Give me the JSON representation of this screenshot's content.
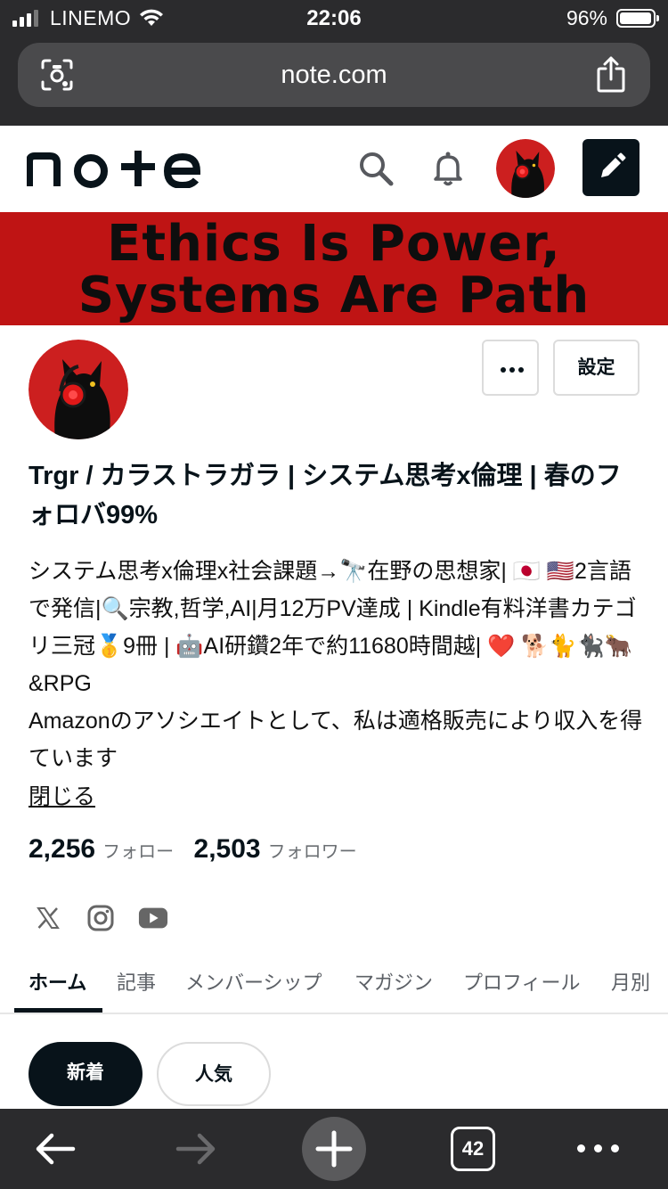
{
  "status_bar": {
    "carrier": "LINEMO",
    "time": "22:06",
    "battery_percent": "96%"
  },
  "browser": {
    "url": "note.com",
    "open_tabs": "42"
  },
  "header": {
    "logo": "note"
  },
  "banner": {
    "line1": "Ethics Is Power,",
    "line2": "Systems Are Path",
    "background": "#bf1414"
  },
  "profile": {
    "settings_label": "設定",
    "name": "Trgr / カラストラガラ | システム思考x倫理 | 春のフォロバ99%",
    "bio_lines": [
      "システム思考x倫理x社会課題→🔭在野の思想家| 🇯🇵 🇺🇸2言語で発信|🔍宗教,哲学,AI|月12万PV達成 | Kindle有料洋書カテゴリ三冠🥇9冊 | 🤖AI研鑽2年で約11680時間越| ❤️ 🐕🐈🐈‍⬛🐂&RPG",
      "Amazonのアソシエイトとして、私は適格販売により収入を得ています"
    ],
    "close_link": "閉じる",
    "following_count": "2,256",
    "following_label": "フォロー",
    "followers_count": "2,503",
    "followers_label": "フォロワー"
  },
  "tabs": [
    {
      "label": "ホーム",
      "active": true
    },
    {
      "label": "記事",
      "active": false
    },
    {
      "label": "メンバーシップ",
      "active": false
    },
    {
      "label": "マガジン",
      "active": false
    },
    {
      "label": "プロフィール",
      "active": false
    },
    {
      "label": "月別",
      "active": false
    }
  ],
  "filters": {
    "new_label": "新着",
    "popular_label": "人気"
  },
  "icons": [
    "reader-icon",
    "share-icon",
    "search-icon",
    "bell-icon",
    "pencil-icon",
    "more-icon",
    "x-icon",
    "instagram-icon",
    "youtube-icon",
    "back-arrow-icon",
    "forward-arrow-icon",
    "plus-icon"
  ],
  "colors": {
    "brand_dark": "#08131a",
    "chrome": "#2b2b2d"
  }
}
